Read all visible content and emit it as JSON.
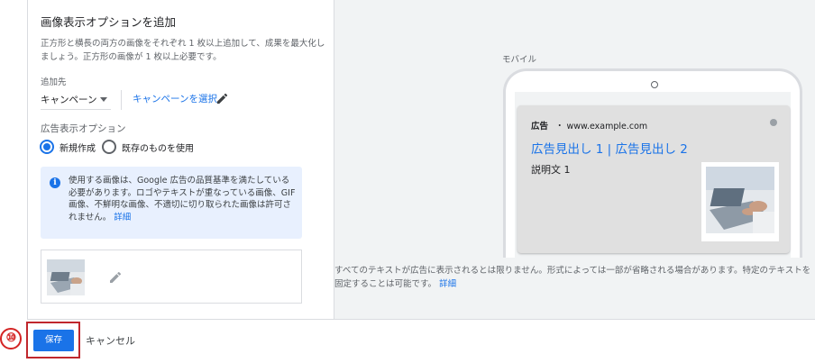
{
  "form": {
    "title": "画像表示オプションを追加",
    "description": "正方形と横長の両方の画像をそれぞれ 1 枚以上追加して、成果を最大化しましょう。正方形の画像が 1 枚以上必要です。",
    "destination_label": "追加先",
    "campaign_select_value": "キャンペーン",
    "select_campaign_link": "キャンペーンを選択",
    "ad_option_label": "広告表示オプション",
    "radio_new_label": "新規作成",
    "radio_existing_label": "既存のものを使用",
    "info_text": "使用する画像は、Google 広告の品質基準を満たしている必要があります。ロゴやテキストが重なっている画像、GIF 画像、不鮮明な画像、不適切に切り取られた画像は許可されません。",
    "info_link": "詳細"
  },
  "preview": {
    "mobile_label": "モバイル",
    "ad_badge": "広告",
    "ad_url": "・ www.example.com",
    "headline": "広告見出し 1 | 広告見出し 2",
    "description": "説明文 1",
    "disclaimer": "すべてのテキストが広告に表示されるとは限りません。形式によっては一部が省略される場合があります。特定のテキストを固定することは可能です。",
    "disclaimer_link": "詳細"
  },
  "footer": {
    "step_marker": "⑩",
    "save_label": "保存",
    "cancel_label": "キャンセル"
  },
  "colors": {
    "accent": "#1a73e8",
    "highlight": "#c0272d",
    "info_bg": "#e8f0fe",
    "preview_bg": "#f1f3f4"
  },
  "icons": {
    "pencil": "pencil-icon",
    "info": "info-icon",
    "dropdown": "caret-down-icon"
  }
}
